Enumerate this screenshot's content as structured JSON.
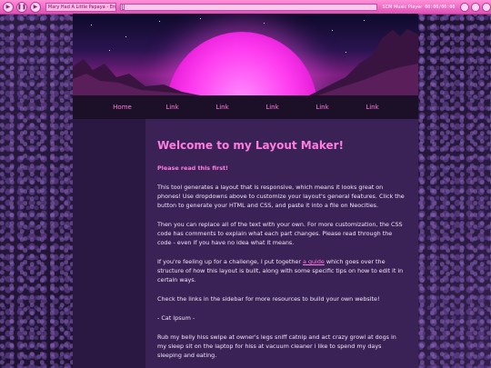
{
  "player": {
    "track": "Mary Had A Little Papaya - Emrey",
    "name": "SCM Music Player",
    "time": "00:00/00:00",
    "progress": 0.01
  },
  "nav": {
    "items": [
      "Home",
      "Link",
      "Link",
      "Link",
      "Link",
      "Link"
    ]
  },
  "main": {
    "title": "Welcome to my Layout Maker!",
    "read_first": "Please read this first!",
    "p1": "This tool generates a layout that is responsive, which means it looks great on phones! Use dropdowns above to customize your layout's general features. Click the button to generate your HTML and CSS, and paste it into a file on Neocities.",
    "p2": "Then you can replace all of the text with your own. For more customization, the CSS code has comments to explain what each part changes. Please read through the code - even if you have no idea what it means.",
    "p3_before": "If you're feeling up for a challenge, I put together ",
    "p3_link": "a guide",
    "p3_after": " which goes over the structure of how this layout is built, along with some specific tips on how to edit it in certain ways.",
    "p4": "Check the links in the sidebar for more resources to build your own website!",
    "p5": "- Cat Ipsum -",
    "p6": "Rub my belly hiss swipe at owner's legs sniff catnip and act crazy growl at dogs in my sleep sit on the laptop for hiss at vacuum cleaner i like to spend my days sleeping and eating."
  },
  "colors": {
    "accent": "#ff7ce0",
    "content_bg": "#3b2256",
    "sidebar_bg": "#2a1742",
    "nav_bg": "#1c1028",
    "player_bg": "#e04fb6"
  }
}
